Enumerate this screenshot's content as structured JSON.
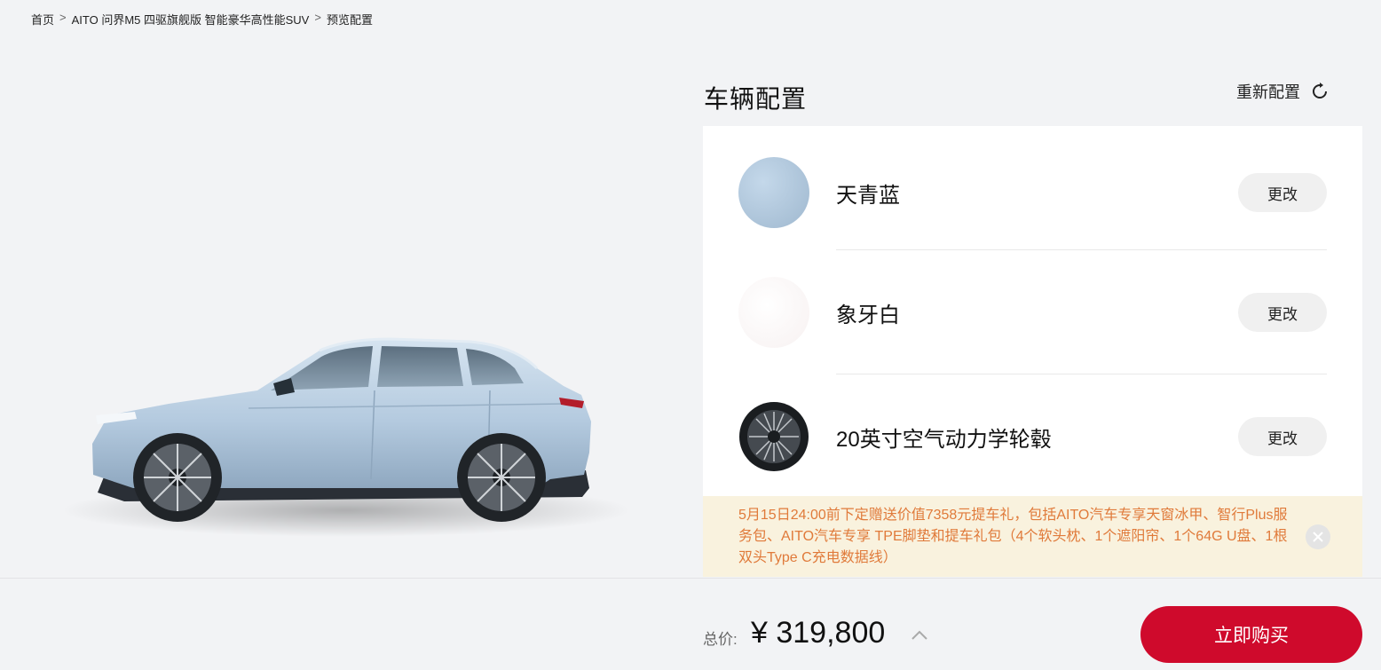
{
  "breadcrumb": {
    "items": [
      "首页",
      "AITO 问界M5 四驱旗舰版 智能豪华高性能SUV",
      "预览配置"
    ],
    "separator": ">"
  },
  "config": {
    "title": "车辆配置",
    "reset_label": "重新配置",
    "options": [
      {
        "label": "天青蓝",
        "change_label": "更改",
        "swatch": "#a9c4db"
      },
      {
        "label": "象牙白",
        "change_label": "更改",
        "swatch": "#fbf8f7"
      },
      {
        "label": "20英寸空气动力学轮毂",
        "change_label": "更改",
        "icon": "wheel-icon"
      }
    ]
  },
  "promo": {
    "text": "5月15日24:00前下定赠送价值7358元提车礼，包括AITO汽车专享天窗冰甲、智行Plus服务包、AITO汽车专享 TPE脚垫和提车礼包（4个软头枕、1个遮阳帘、1个64G U盘、1根双头Type C充电数据线）"
  },
  "footer": {
    "total_label": "总价:",
    "total_price": "¥ 319,800",
    "buy_label": "立即购买"
  },
  "colors": {
    "accent": "#cf0a2c",
    "promo_text": "#e07a3a",
    "promo_bg": "#f9f2de",
    "car_body": "#b7cde2"
  }
}
